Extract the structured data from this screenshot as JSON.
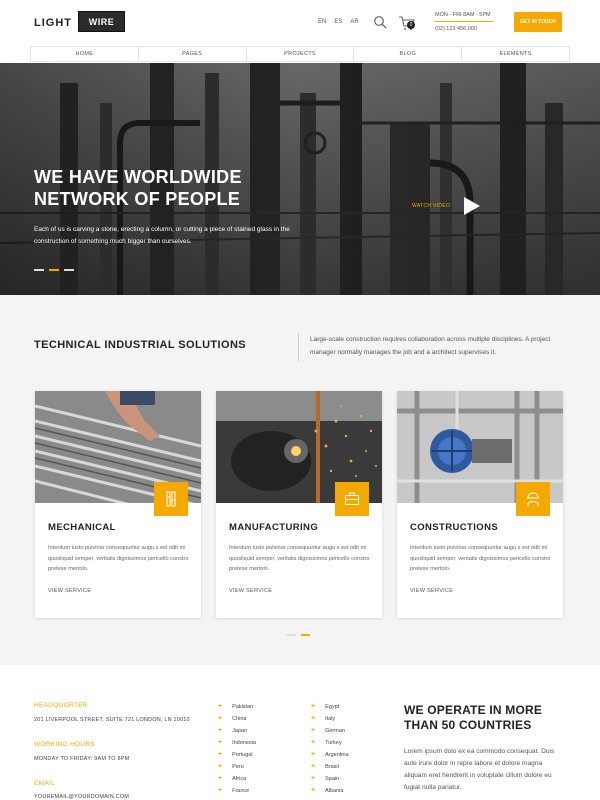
{
  "header": {
    "logo_light": "LIGHT",
    "logo_wire": "WIRE",
    "languages": [
      "EN",
      "ES",
      "AR"
    ],
    "cart_count": "0",
    "hours": "MON - FRI 8AM - 5PM",
    "phone": "(02) 123 456.000",
    "cta": "GET IN TOUCH"
  },
  "nav": [
    "HOME",
    "PAGES",
    "PROJECTS",
    "BLOG",
    "ELEMENTS"
  ],
  "hero": {
    "title_line1": "WE HAVE WORLDWIDE",
    "title_line2": "NETWORK OF PEOPLE",
    "text": "Each of us is carving a stone, erecting a column, or cutting a piece of stained glass in the construction of something much bigger than ourselves.",
    "watch": "WATCH VIDEO"
  },
  "solutions": {
    "title": "TECHNICAL INDUSTRIAL SOLUTIONS",
    "text": "Large-scale construction requires collaboration across multiple disciplines. A project manager normally manages the job and a architect supervises it."
  },
  "cards": [
    {
      "title": "MECHANICAL",
      "text": "Interdum iusto pulvinar consequuntur augu s est odit mi quosliquid semper, veritatis dignissimos pericello constro pretese mertolo.",
      "link": "VIEW SERVICE"
    },
    {
      "title": "MANUFACTURING",
      "text": "Interdum iusto pulvinar consequuntur augu s est odit mi quosliquid semper, veritatis dignissimos pericello constro pretese mertolo.",
      "link": "VIEW SERVICE"
    },
    {
      "title": "CONSTRUCTIONS",
      "text": "Interdum iusto pulvinar consequuntur augu s est odit mi quosliquid semper, veritatis dignissimos pericello constro pretese mertolo.",
      "link": "VIEW SERVICE"
    }
  ],
  "footer": {
    "hq_label": "HEADQUORTER",
    "hq_value": "201 LIVERPOOL STREET, SUITE 721 LONDON, LN 10010",
    "hours_label": "WORKING HOURS",
    "hours_value": "MONDAY TO FRIDAY: 9AM TO 8PM",
    "email_label": "EMAIL",
    "email_value": "YOUREMAIL@YOURDOMAIN.COM",
    "countries_col1": [
      "Pakistan",
      "China",
      "Japan",
      "Indonesia",
      "Portugal",
      "Peru",
      "Africa",
      "France"
    ],
    "countries_col2": [
      "Egypt",
      "Italy",
      "German",
      "Turkey",
      "Argentina",
      "Brasil",
      "Spain",
      "Albania"
    ],
    "operate_title": "WE OPERATE IN MORE THAN 50 COUNTRIES",
    "operate_text": "Lorem ipsum dolo ex ea commodo consequat. Duis aute irure dolor in repre labore et dolore magna aliquam eret hendrerit in voluptate cillum dolore eu fugiat nulla pariatur."
  },
  "colors": {
    "accent": "#f5a800",
    "dark": "#222222"
  }
}
